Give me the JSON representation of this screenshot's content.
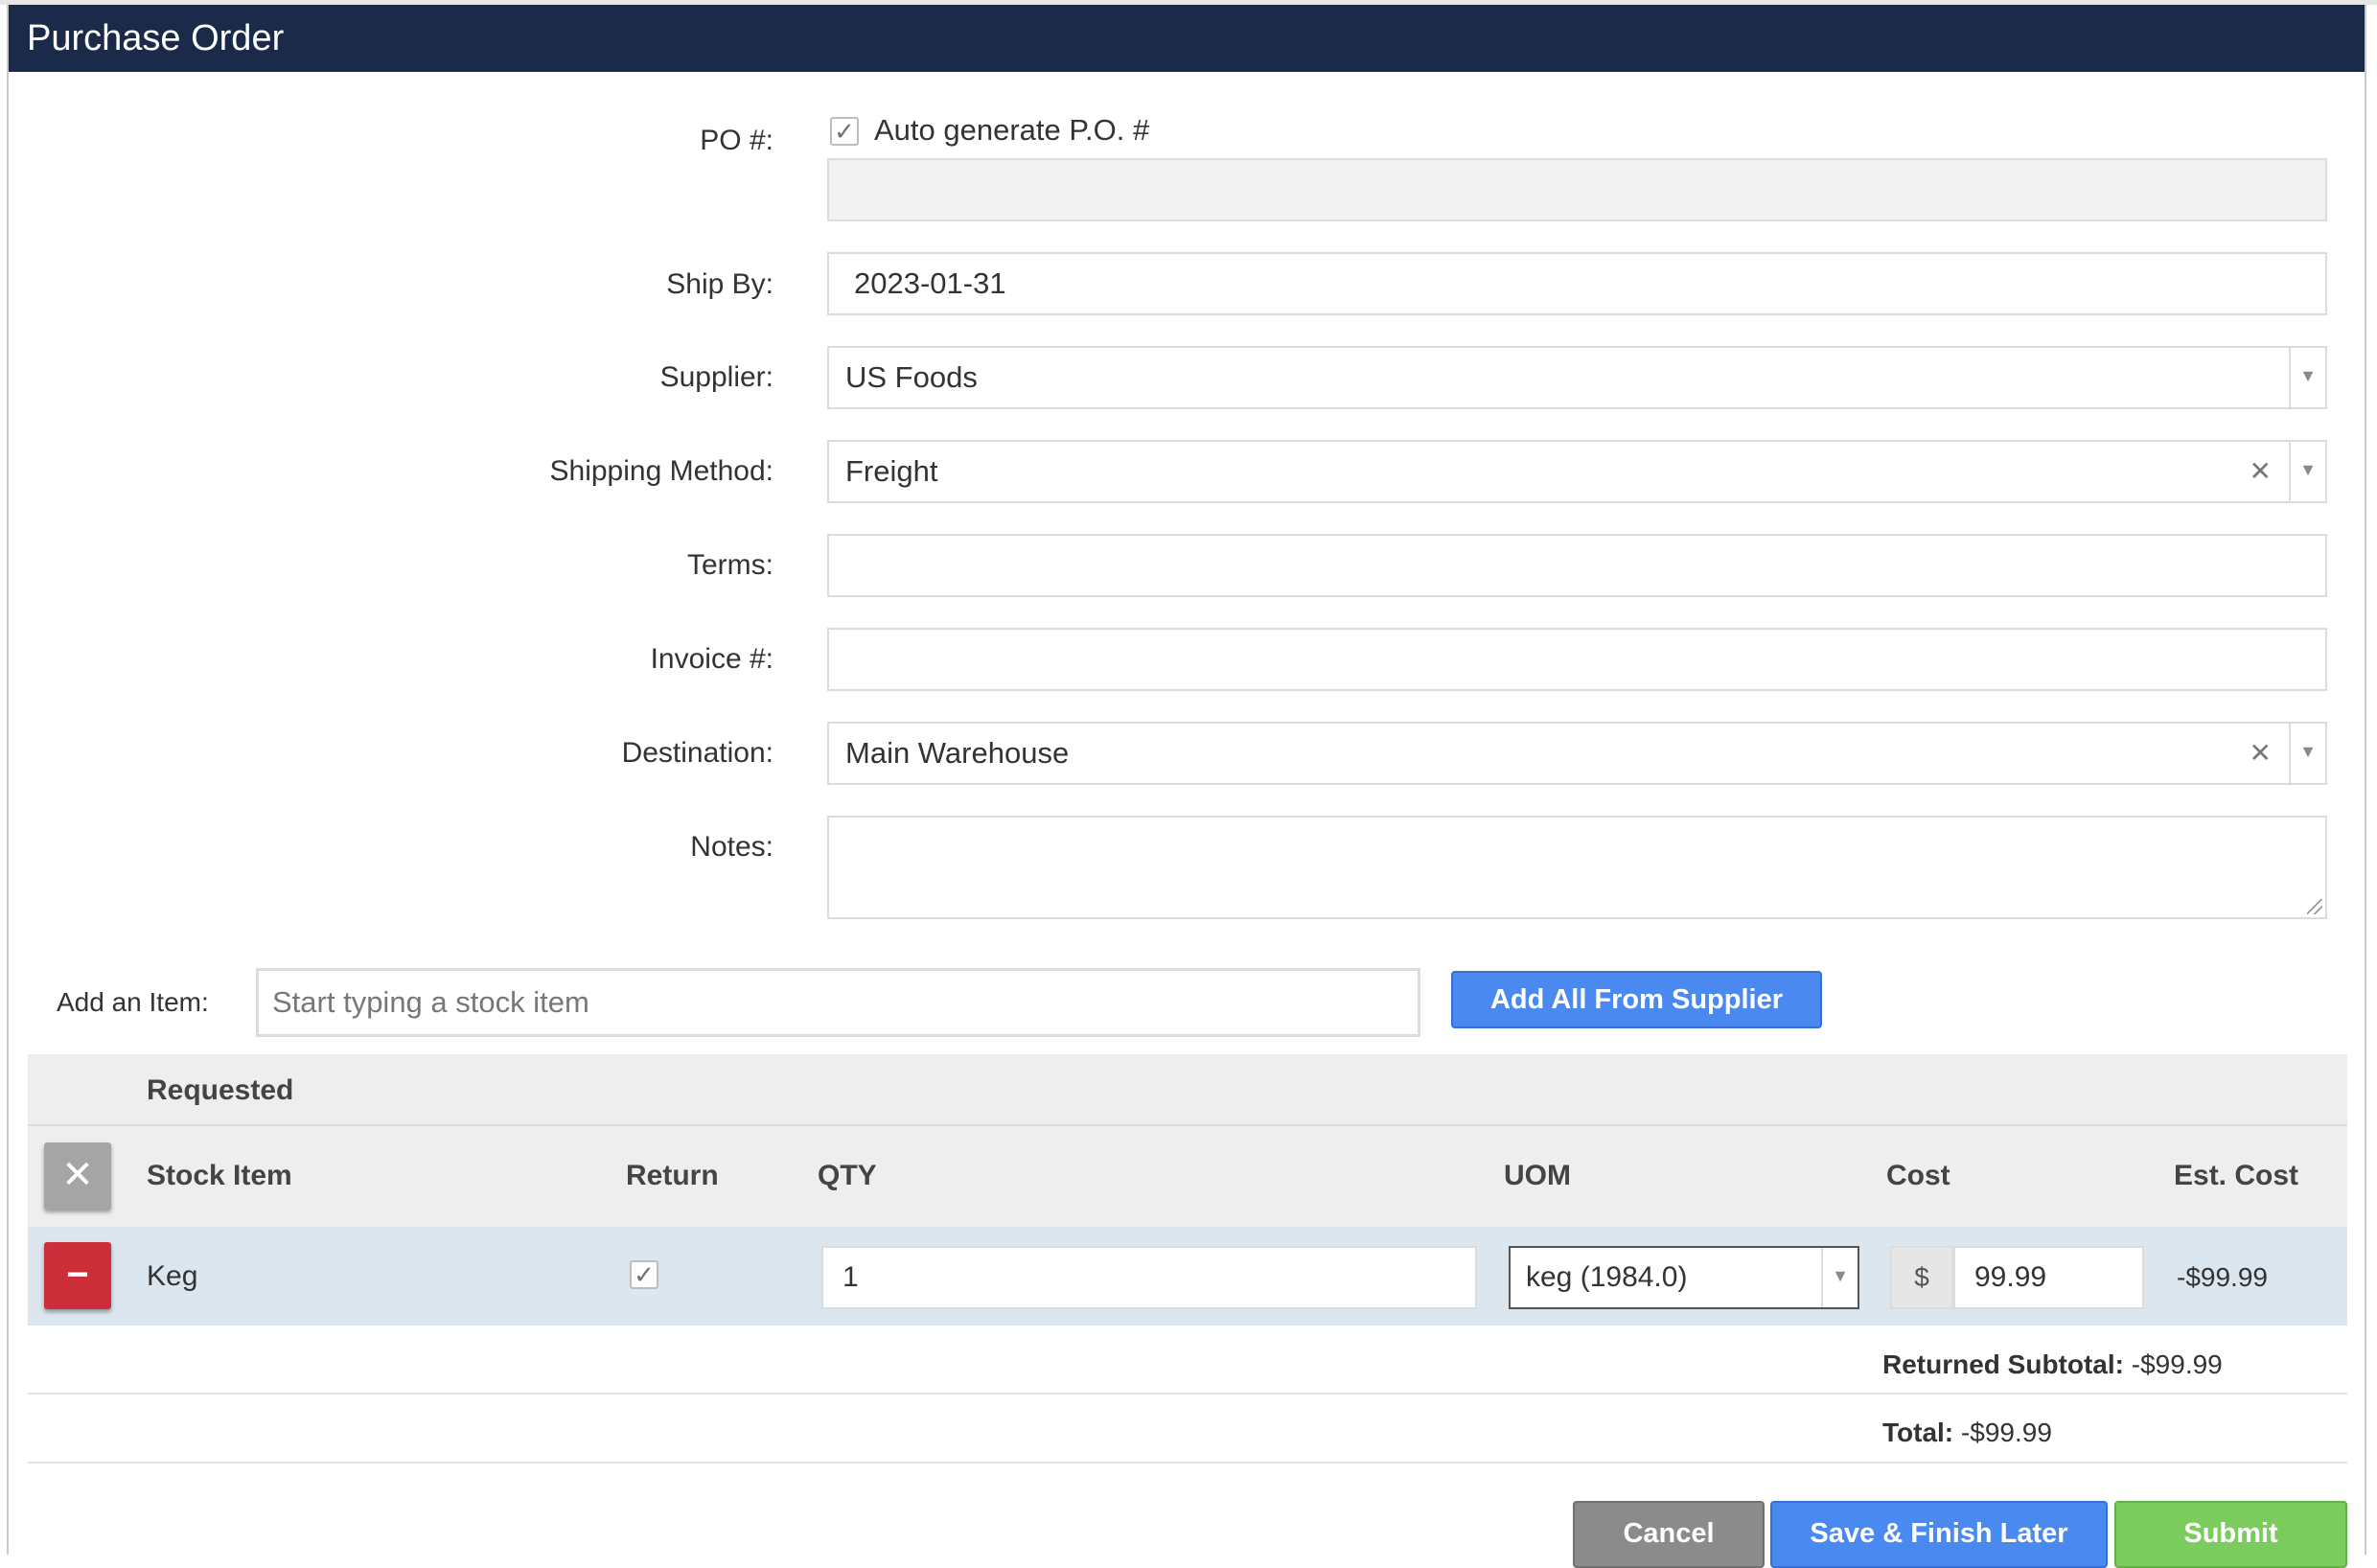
{
  "window": {
    "title": "Purchase Order"
  },
  "po": {
    "label": "PO #:",
    "auto_generate_label": "Auto generate P.O. #",
    "auto_generate_checked": true,
    "value": ""
  },
  "ship_by": {
    "label": "Ship By:",
    "value": "2023-01-31"
  },
  "supplier": {
    "label": "Supplier:",
    "value": "US Foods"
  },
  "shipping_method": {
    "label": "Shipping Method:",
    "value": "Freight"
  },
  "terms": {
    "label": "Terms:",
    "value": ""
  },
  "invoice": {
    "label": "Invoice #:",
    "value": ""
  },
  "destination": {
    "label": "Destination:",
    "value": "Main Warehouse"
  },
  "notes": {
    "label": "Notes:",
    "value": ""
  },
  "add_item": {
    "label": "Add an Item:",
    "placeholder": "Start typing a stock item",
    "add_all_label": "Add All From Supplier"
  },
  "table": {
    "group_header": "Requested",
    "columns": {
      "stock_item": "Stock Item",
      "return": "Return",
      "qty": "QTY",
      "uom": "UOM",
      "cost": "Cost",
      "est_cost": "Est. Cost"
    },
    "rows": [
      {
        "stock_item": "Keg",
        "return_checked": true,
        "qty": "1",
        "uom": "keg (1984.0)",
        "currency": "$",
        "cost": "99.99",
        "est_cost": "-$99.99"
      }
    ]
  },
  "summary": {
    "returned_subtotal_label": "Returned Subtotal:",
    "returned_subtotal_value": "-$99.99",
    "total_label": "Total:",
    "total_value": "-$99.99"
  },
  "actions": {
    "cancel": "Cancel",
    "save_later": "Save & Finish Later",
    "submit": "Submit"
  },
  "icons": {
    "check": "✓",
    "dropdown": "▼",
    "clear": "✕",
    "remove_all": "✕",
    "remove_row": "−"
  },
  "colors": {
    "titlebar": "#1b2a48",
    "primary_button": "#4a8af0",
    "danger_button": "#cc2f3a",
    "success_button": "#7ccc5d",
    "row_highlight": "#dbe6ef"
  }
}
